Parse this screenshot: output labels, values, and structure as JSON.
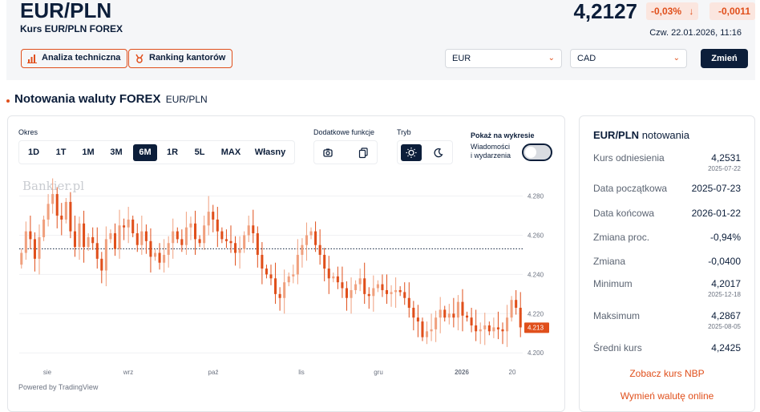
{
  "header": {
    "pair": "EUR/PLN",
    "subtitle": "Kurs EUR/PLN FOREX",
    "rate": "4,2127",
    "change_pct": "-0,03%",
    "change_abs": "-0,0011",
    "datetime": "Czw. 22.01.2026, 11:16",
    "btn_analysis": "Analiza techniczna",
    "btn_ranking": "Ranking kantorów",
    "select_from": "EUR",
    "select_to": "CAD",
    "btn_change": "Zmień"
  },
  "section": {
    "title": "Notowania waluty FOREX",
    "sub": "EUR/PLN"
  },
  "controls": {
    "okres_label": "Okres",
    "periods": [
      "1D",
      "1T",
      "1M",
      "3M",
      "6M",
      "1R",
      "5L",
      "MAX",
      "Własny"
    ],
    "active_period": "6M",
    "extra_label": "Dodatkowe funkcje",
    "mode_label": "Tryb",
    "show_label": "Pokaż na wykresie",
    "events_label_1": "Wiadomości",
    "events_label_2": "i wydarzenia"
  },
  "chart_data": {
    "type": "candlestick",
    "y_ticks": [
      "4.280",
      "4.260",
      "4.240",
      "4.220",
      "4.200"
    ],
    "ylim": [
      4.196,
      4.288
    ],
    "x_ticks": [
      "sie",
      "wrz",
      "paź",
      "lis",
      "gru",
      "2026",
      "20"
    ],
    "last_value": "4.213",
    "reference_line": 4.2531,
    "watermark": "Bankier.pl",
    "powered": "Powered by TradingView",
    "closes": [
      4.251,
      4.262,
      4.258,
      4.248,
      4.259,
      4.268,
      4.276,
      4.281,
      4.27,
      4.268,
      4.277,
      4.262,
      4.254,
      4.266,
      4.254,
      4.259,
      4.256,
      4.248,
      4.242,
      4.258,
      4.261,
      4.253,
      4.265,
      4.264,
      4.268,
      4.261,
      4.255,
      4.262,
      4.257,
      4.249,
      4.251,
      4.246,
      4.25,
      4.256,
      4.262,
      4.258,
      4.255,
      4.264,
      4.266,
      4.258,
      4.256,
      4.265,
      4.272,
      4.268,
      4.262,
      4.258,
      4.257,
      4.256,
      4.251,
      4.253,
      4.26,
      4.265,
      4.261,
      4.25,
      4.243,
      4.24,
      4.238,
      4.23,
      4.228,
      4.236,
      4.239,
      4.24,
      4.25,
      4.255,
      4.26,
      4.262,
      4.255,
      4.25,
      4.243,
      4.238,
      4.239,
      4.236,
      4.233,
      4.228,
      4.232,
      4.235,
      4.238,
      4.23,
      4.229,
      4.233,
      4.235,
      4.232,
      4.23,
      4.231,
      4.232,
      4.231,
      4.228,
      4.223,
      4.218,
      4.216,
      4.208,
      4.211,
      4.212,
      4.218,
      4.222,
      4.218,
      4.22,
      4.218,
      4.226,
      4.219,
      4.218,
      4.214,
      4.211,
      4.212,
      4.214,
      4.211,
      4.213,
      4.212,
      4.211,
      4.218,
      4.227,
      4.223,
      4.213
    ],
    "opens": [
      4.245,
      4.251,
      4.262,
      4.258,
      4.248,
      4.259,
      4.268,
      4.276,
      4.281,
      4.27,
      4.268,
      4.277,
      4.262,
      4.254,
      4.266,
      4.254,
      4.259,
      4.256,
      4.248,
      4.242,
      4.258,
      4.261,
      4.253,
      4.265,
      4.264,
      4.268,
      4.261,
      4.255,
      4.262,
      4.257,
      4.249,
      4.251,
      4.246,
      4.25,
      4.256,
      4.262,
      4.258,
      4.255,
      4.264,
      4.266,
      4.258,
      4.256,
      4.265,
      4.272,
      4.268,
      4.262,
      4.258,
      4.257,
      4.256,
      4.251,
      4.253,
      4.26,
      4.265,
      4.261,
      4.25,
      4.243,
      4.24,
      4.238,
      4.23,
      4.228,
      4.236,
      4.239,
      4.24,
      4.25,
      4.255,
      4.26,
      4.262,
      4.255,
      4.25,
      4.243,
      4.238,
      4.239,
      4.236,
      4.233,
      4.228,
      4.232,
      4.235,
      4.238,
      4.23,
      4.229,
      4.233,
      4.235,
      4.232,
      4.23,
      4.231,
      4.232,
      4.231,
      4.228,
      4.223,
      4.218,
      4.216,
      4.208,
      4.211,
      4.212,
      4.218,
      4.222,
      4.218,
      4.22,
      4.218,
      4.226,
      4.219,
      4.218,
      4.214,
      4.211,
      4.212,
      4.214,
      4.211,
      4.213,
      4.212,
      4.211,
      4.218,
      4.227,
      4.223
    ]
  },
  "sidebar": {
    "title_pair": "EUR/PLN",
    "title_suffix": "notowania",
    "rows": [
      {
        "label": "Kurs odniesienia",
        "value": "4,2531",
        "date": "2025-07-22"
      },
      {
        "label": "Data początkowa",
        "value": "2025-07-23",
        "date": ""
      },
      {
        "label": "Data końcowa",
        "value": "2026-01-22",
        "date": ""
      },
      {
        "label": "Zmiana proc.",
        "value": "-0,94%",
        "date": ""
      },
      {
        "label": "Zmiana",
        "value": "-0,0400",
        "date": ""
      },
      {
        "label": "Minimum",
        "value": "4,2017",
        "date": "2025-12-18"
      },
      {
        "label": "Maksimum",
        "value": "4,2867",
        "date": "2025-08-05"
      },
      {
        "label": "Średni kurs",
        "value": "4,2425",
        "date": ""
      }
    ],
    "link_nbp": "Zobacz kurs NBP",
    "link_exchange": "Wymień walutę online"
  },
  "colors": {
    "accent": "#e04f1b",
    "navy": "#0c1e3a"
  }
}
